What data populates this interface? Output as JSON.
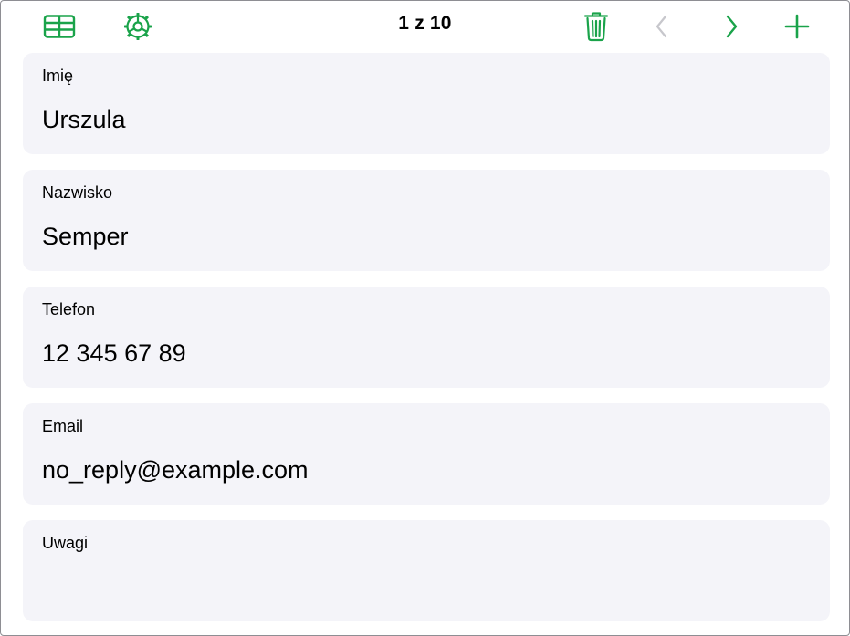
{
  "colors": {
    "accent": "#1aa34a",
    "disabled": "#c7c7cc",
    "card_bg": "#f4f4f9"
  },
  "toolbar": {
    "table_icon": "table-icon",
    "settings_icon": "gear-icon",
    "record_counter": "1 z 10",
    "delete_icon": "trash-icon",
    "prev_icon": "chevron-left-icon",
    "next_icon": "chevron-right-icon",
    "add_icon": "plus-icon"
  },
  "fields": [
    {
      "label": "Imię",
      "value": "Urszula"
    },
    {
      "label": "Nazwisko",
      "value": "Semper"
    },
    {
      "label": "Telefon",
      "value": "12 345 67 89"
    },
    {
      "label": "Email",
      "value": "no_reply@example.com"
    },
    {
      "label": "Uwagi",
      "value": ""
    }
  ]
}
